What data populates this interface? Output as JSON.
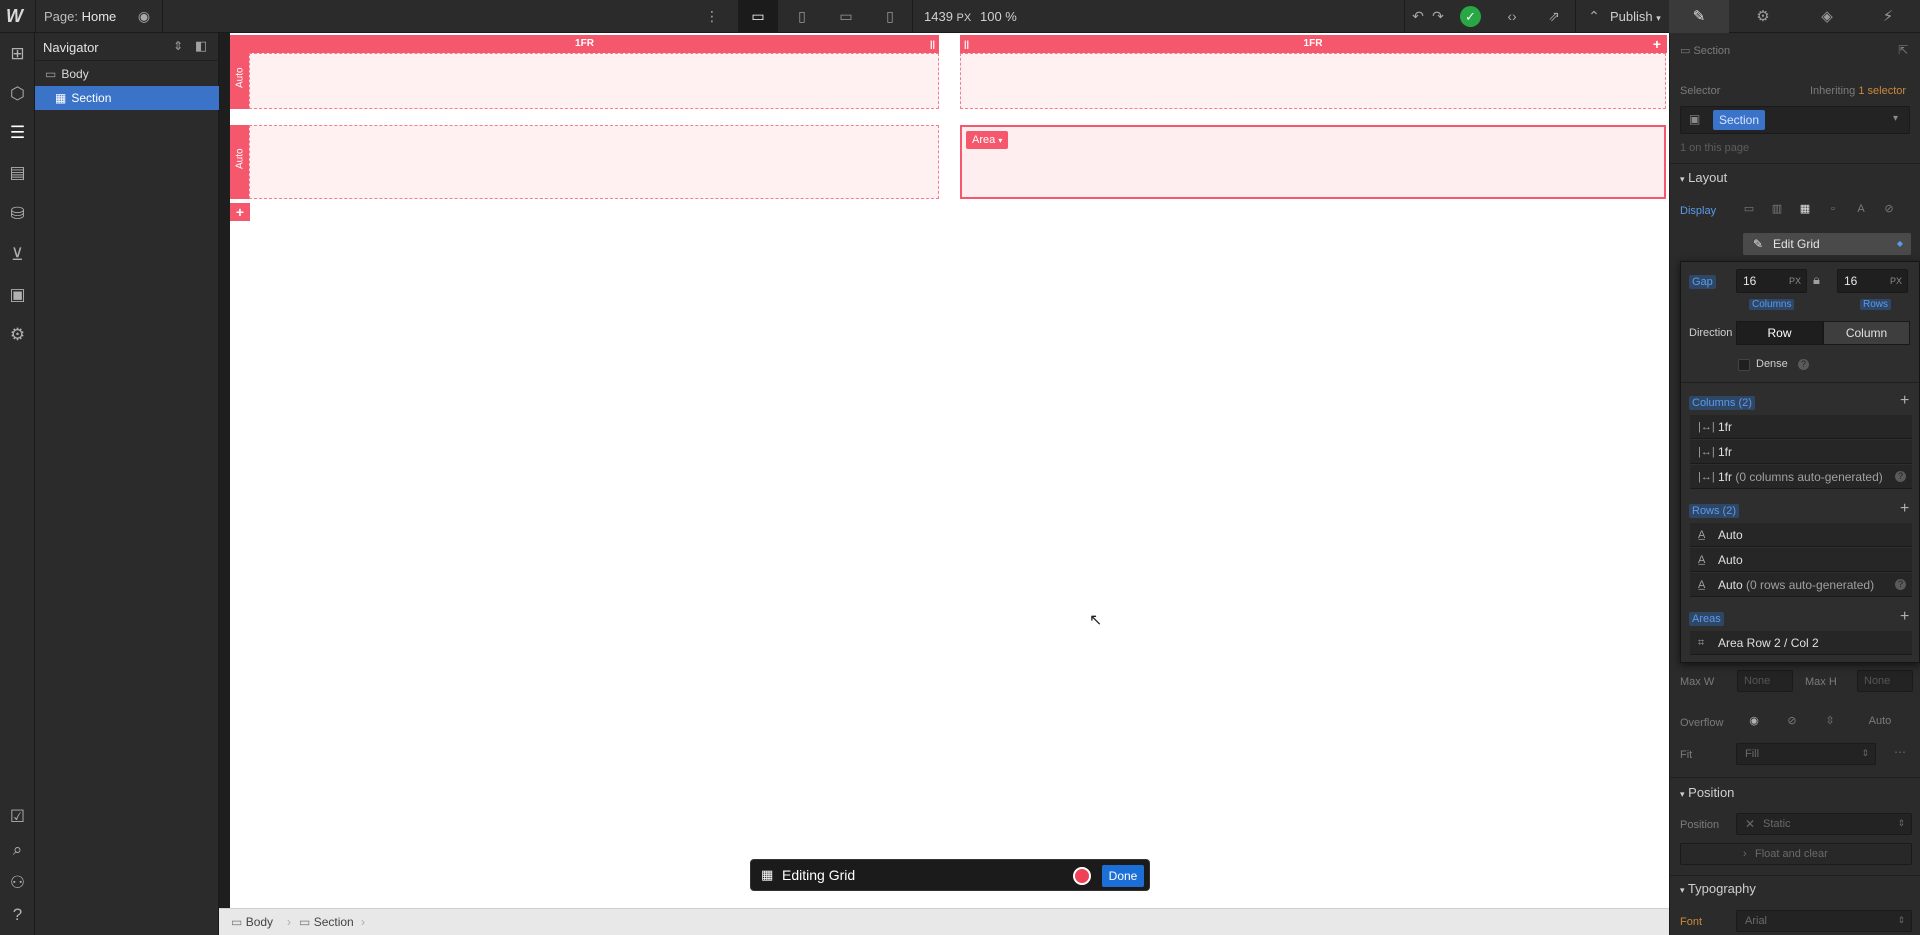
{
  "topbar": {
    "logo": "W",
    "page_prefix": "Page:",
    "page_name": "Home",
    "canvas_width": "1439",
    "canvas_unit": "PX",
    "zoom": "100 %",
    "publish_label": "Publish"
  },
  "left_rail": {
    "icons": [
      "add-icon",
      "cube-icon",
      "navigator-icon",
      "pages-icon",
      "cms-icon",
      "ecommerce-icon",
      "assets-icon",
      "settings-icon",
      "audit-icon",
      "search-icon",
      "users-icon",
      "help-icon"
    ]
  },
  "navigator": {
    "title": "Navigator",
    "items": [
      {
        "label": "Body",
        "selected": false
      },
      {
        "label": "Section",
        "selected": true
      }
    ]
  },
  "canvas": {
    "columns": [
      {
        "label": "1FR"
      },
      {
        "label": "1FR"
      }
    ],
    "rows": [
      {
        "label": "Auto"
      },
      {
        "label": "Auto"
      }
    ],
    "area_tag": "Area",
    "edit_bar": {
      "label": "Editing Grid",
      "done_label": "Done"
    }
  },
  "breadcrumb": {
    "items": [
      "Body",
      "Section"
    ]
  },
  "right_panel": {
    "element_label": "Section",
    "selector_label": "Selector",
    "inheriting_prefix": "Inheriting",
    "inheriting_count": "1",
    "inheriting_suffix": "selector",
    "selector_chip": "Section",
    "on_page": "1 on this page",
    "layout_header": "Layout",
    "display_label": "Display",
    "edit_grid_label": "Edit Grid",
    "grid_popup": {
      "gap_label": "Gap",
      "gap_columns": "16",
      "gap_rows": "16",
      "unit": "PX",
      "columns_label": "Columns",
      "rows_label": "Rows",
      "direction_label": "Direction",
      "direction_options": [
        "Row",
        "Column"
      ],
      "dense_label": "Dense",
      "columns_header": "Columns (2)",
      "column_tracks": [
        {
          "value": "1fr",
          "note": ""
        },
        {
          "value": "1fr",
          "note": ""
        },
        {
          "value": "1fr",
          "note": "(0 columns auto-generated)"
        }
      ],
      "rows_header": "Rows (2)",
      "row_tracks": [
        {
          "value": "Auto",
          "note": ""
        },
        {
          "value": "Auto",
          "note": ""
        },
        {
          "value": "Auto",
          "note": "(0 rows auto-generated)"
        }
      ],
      "areas_header": "Areas",
      "areas": [
        "Area Row 2 / Col 2"
      ]
    },
    "max_w_label": "Max W",
    "max_w_value": "None",
    "max_h_label": "Max H",
    "max_h_value": "None",
    "overflow_label": "Overflow",
    "overflow_auto": "Auto",
    "fit_label": "Fit",
    "fit_value": "Fill",
    "position_header": "Position",
    "position_label": "Position",
    "position_value": "Static",
    "float_label": "Float and clear",
    "typography_header": "Typography",
    "font_label": "Font",
    "font_value": "Arial"
  }
}
